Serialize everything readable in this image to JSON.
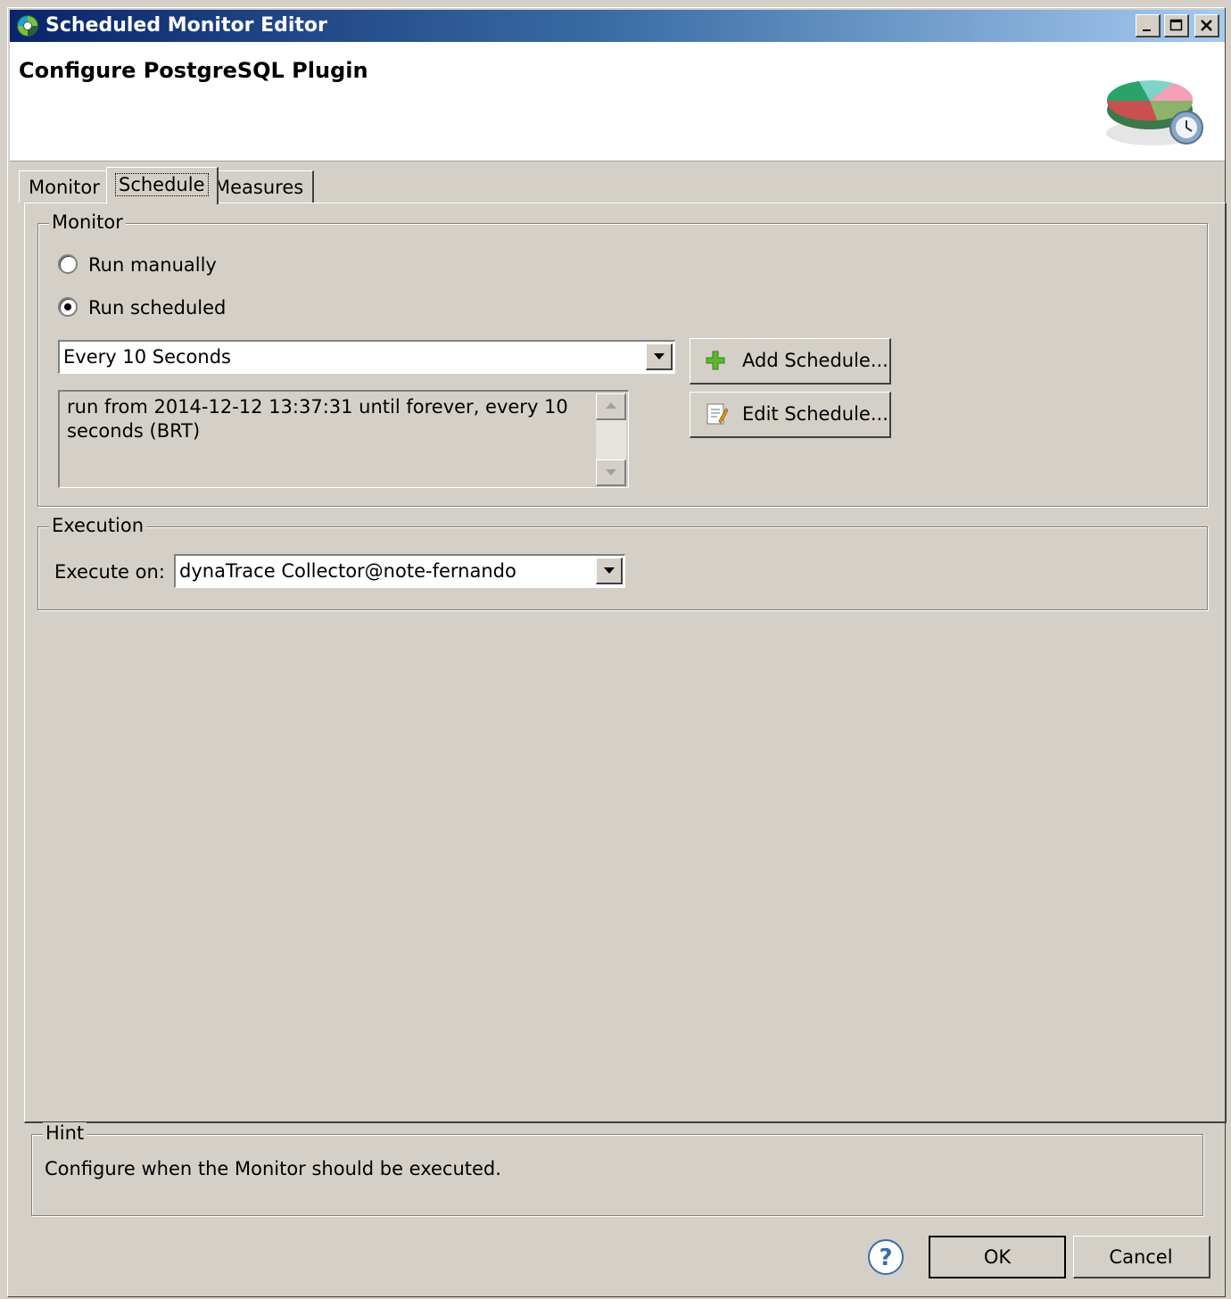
{
  "window": {
    "title": "Scheduled Monitor Editor",
    "app_icon": "dynatrace-logo-icon",
    "caption_buttons": [
      "minimize-icon",
      "maximize-icon",
      "close-icon"
    ]
  },
  "header": {
    "title": "Configure PostgreSQL Plugin",
    "icon": "pie-chart-clock-icon"
  },
  "tabs": [
    {
      "label": "Monitor",
      "active": false
    },
    {
      "label": "Schedule",
      "active": true
    },
    {
      "label": "Measures",
      "active": false
    }
  ],
  "monitor_group": {
    "legend": "Monitor",
    "run_manually_label": "Run manually",
    "run_scheduled_label": "Run scheduled",
    "selected": "Run scheduled",
    "schedule_select_value": "Every 10 Seconds",
    "schedule_description": "run from 2014-12-12 13:37:31 until forever, every 10 seconds (BRT)",
    "add_schedule_label": "Add Schedule...",
    "edit_schedule_label": "Edit Schedule..."
  },
  "execution_group": {
    "legend": "Execution",
    "execute_on_label": "Execute on:",
    "execute_on_value": "dynaTrace Collector@note-fernando"
  },
  "hint": {
    "legend": "Hint",
    "text": "Configure when the Monitor should be executed."
  },
  "footer": {
    "ok_label": "OK",
    "cancel_label": "Cancel",
    "help_icon": "help-icon"
  },
  "colors": {
    "dialog_bg": "#d4d0c8",
    "titlebar_start": "#0a246a",
    "titlebar_end": "#a6caf0",
    "add_icon": "#5cb82d"
  }
}
